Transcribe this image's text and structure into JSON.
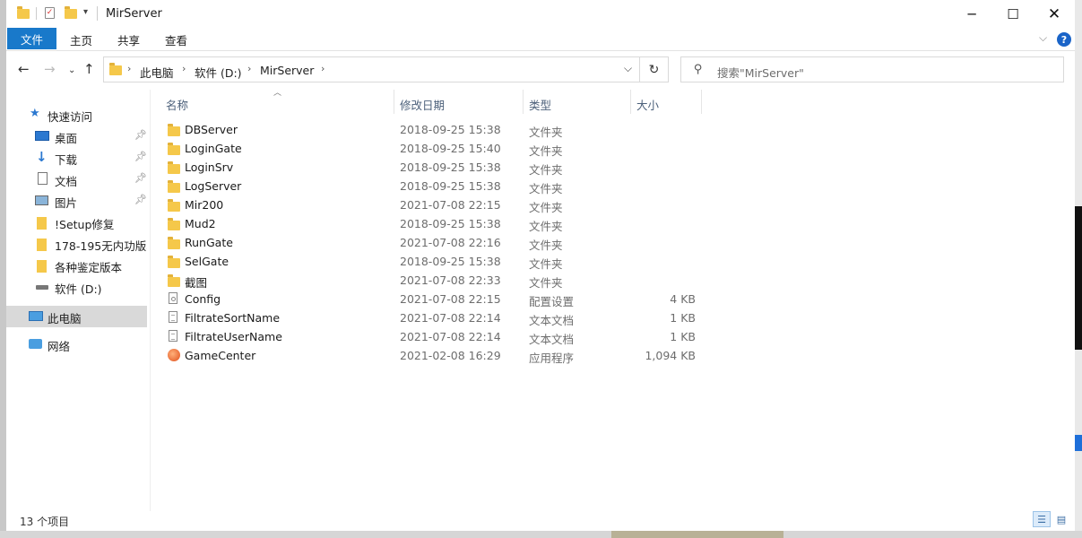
{
  "window": {
    "title": "MirServer"
  },
  "ribbon": {
    "tabs": [
      {
        "label": "文件",
        "active": true
      },
      {
        "label": "主页"
      },
      {
        "label": "共享"
      },
      {
        "label": "查看"
      }
    ],
    "help": "?"
  },
  "address": {
    "crumbs": [
      "此电脑",
      "软件 (D:)",
      "MirServer"
    ]
  },
  "search": {
    "placeholder": "搜索\"MirServer\""
  },
  "nav": {
    "quick_access": "快速访问",
    "items": [
      {
        "label": "桌面",
        "pinned": true,
        "icon": "desktop-icon"
      },
      {
        "label": "下载",
        "pinned": true,
        "icon": "download-icon"
      },
      {
        "label": "文档",
        "pinned": true,
        "icon": "document-icon"
      },
      {
        "label": "图片",
        "pinned": true,
        "icon": "picture-icon"
      },
      {
        "label": "!Setup修复",
        "pinned": false,
        "icon": "folder-icon"
      },
      {
        "label": "178-195无内功版本",
        "pinned": false,
        "icon": "folder-icon"
      },
      {
        "label": "各种鉴定版本",
        "pinned": false,
        "icon": "folder-icon"
      },
      {
        "label": "软件 (D:)",
        "pinned": false,
        "icon": "drive-icon"
      }
    ],
    "this_pc": "此电脑",
    "network": "网络"
  },
  "columns": {
    "name": "名称",
    "date": "修改日期",
    "type": "类型",
    "size": "大小"
  },
  "files": [
    {
      "name": "DBServer",
      "date": "2018-09-25 15:38",
      "type": "文件夹",
      "size": "",
      "icon": "folder"
    },
    {
      "name": "LoginGate",
      "date": "2018-09-25 15:40",
      "type": "文件夹",
      "size": "",
      "icon": "folder"
    },
    {
      "name": "LoginSrv",
      "date": "2018-09-25 15:38",
      "type": "文件夹",
      "size": "",
      "icon": "folder"
    },
    {
      "name": "LogServer",
      "date": "2018-09-25 15:38",
      "type": "文件夹",
      "size": "",
      "icon": "folder"
    },
    {
      "name": "Mir200",
      "date": "2021-07-08 22:15",
      "type": "文件夹",
      "size": "",
      "icon": "folder"
    },
    {
      "name": "Mud2",
      "date": "2018-09-25 15:38",
      "type": "文件夹",
      "size": "",
      "icon": "folder"
    },
    {
      "name": "RunGate",
      "date": "2021-07-08 22:16",
      "type": "文件夹",
      "size": "",
      "icon": "folder"
    },
    {
      "name": "SelGate",
      "date": "2018-09-25 15:38",
      "type": "文件夹",
      "size": "",
      "icon": "folder"
    },
    {
      "name": "截图",
      "date": "2021-07-08 22:33",
      "type": "文件夹",
      "size": "",
      "icon": "folder"
    },
    {
      "name": "Config",
      "date": "2021-07-08 22:15",
      "type": "配置设置",
      "size": "4 KB",
      "icon": "config"
    },
    {
      "name": "FiltrateSortName",
      "date": "2021-07-08 22:14",
      "type": "文本文档",
      "size": "1 KB",
      "icon": "text"
    },
    {
      "name": "FiltrateUserName",
      "date": "2021-07-08 22:14",
      "type": "文本文档",
      "size": "1 KB",
      "icon": "text"
    },
    {
      "name": "GameCenter",
      "date": "2021-02-08 16:29",
      "type": "应用程序",
      "size": "1,094 KB",
      "icon": "app"
    }
  ],
  "status": {
    "count": "13 个项目"
  },
  "colors": {
    "accent": "#1979ca",
    "folder": "#f5c84a",
    "header_text": "#4c607a"
  }
}
